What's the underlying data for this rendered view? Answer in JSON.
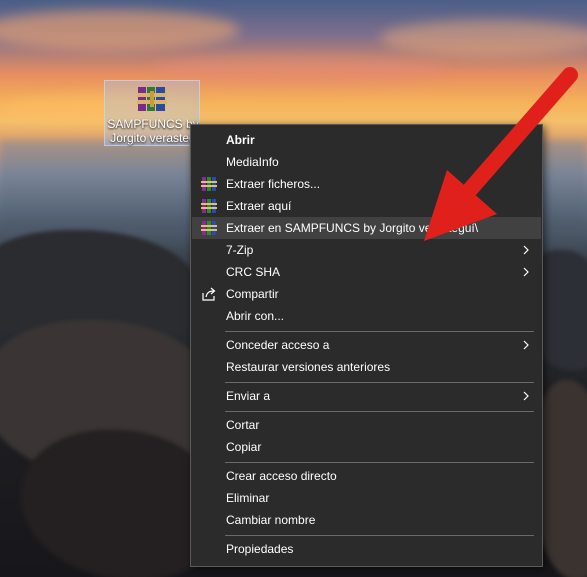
{
  "desktop": {
    "icon_name": "winrar-archive-icon",
    "label_line1": "SAMPFUNCS by",
    "label_line2": "Jorgito verasteg"
  },
  "context_menu": {
    "items": [
      {
        "label": "Abrir",
        "icon": null,
        "submenu": false
      },
      {
        "label": "MediaInfo",
        "icon": null,
        "submenu": false
      },
      {
        "label": "Extraer ficheros...",
        "icon": "winrar-icon",
        "submenu": false
      },
      {
        "label": "Extraer aquí",
        "icon": "winrar-icon",
        "submenu": false
      },
      {
        "label": "Extraer en SAMPFUNCS by Jorgito verasteguí\\",
        "icon": "winrar-icon",
        "submenu": false
      },
      {
        "label": "7-Zip",
        "icon": null,
        "submenu": true
      },
      {
        "label": "CRC SHA",
        "icon": null,
        "submenu": true
      },
      {
        "label": "Compartir",
        "icon": "share-icon",
        "submenu": false
      },
      {
        "label": "Abrir con...",
        "icon": null,
        "submenu": false
      },
      {
        "label": "Conceder acceso a",
        "icon": null,
        "submenu": true
      },
      {
        "label": "Restaurar versiones anteriores",
        "icon": null,
        "submenu": false
      },
      {
        "label": "Enviar a",
        "icon": null,
        "submenu": true
      },
      {
        "label": "Cortar",
        "icon": null,
        "submenu": false
      },
      {
        "label": "Copiar",
        "icon": null,
        "submenu": false
      },
      {
        "label": "Crear acceso directo",
        "icon": null,
        "submenu": false
      },
      {
        "label": "Eliminar",
        "icon": null,
        "submenu": false
      },
      {
        "label": "Cambiar nombre",
        "icon": null,
        "submenu": false
      },
      {
        "label": "Propiedades",
        "icon": null,
        "submenu": false
      }
    ],
    "highlighted_item": "Extraer en SAMPFUNCS by Jorgito verasteguí\\"
  },
  "annotation": {
    "arrow_color": "#e0201b"
  }
}
